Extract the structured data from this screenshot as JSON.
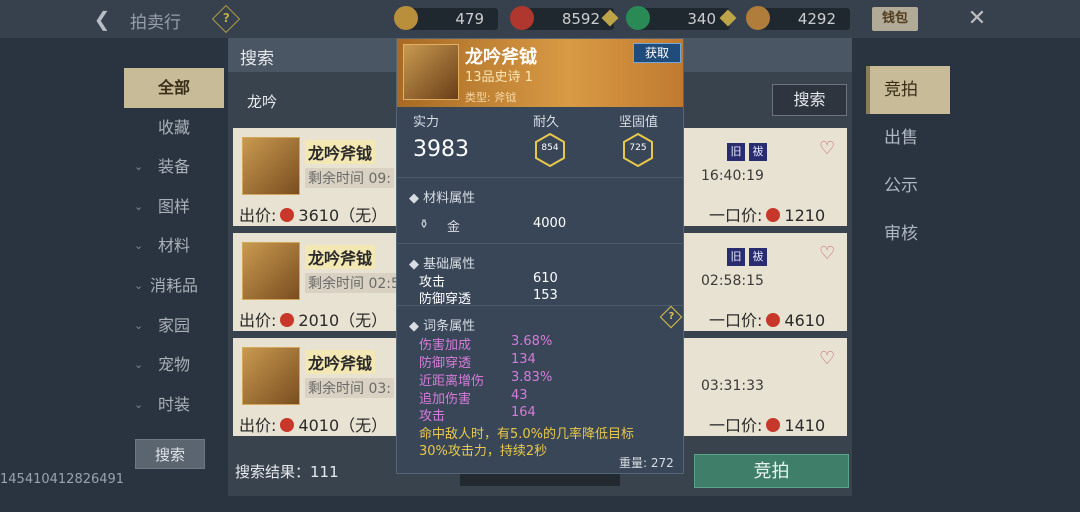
{
  "header": {
    "title": "拍卖行",
    "currencies": [
      "479",
      "8592",
      "340",
      "4292"
    ],
    "wallet_label": "钱包"
  },
  "nav": {
    "categories": [
      "全部",
      "收藏",
      "装备",
      "图样",
      "材料",
      "消耗品",
      "家园",
      "宠物",
      "时装"
    ],
    "search_label": "搜索"
  },
  "uid": "145410412826491",
  "main": {
    "panel_title": "搜索",
    "keyword": "龙吟",
    "search_label": "搜索",
    "result_text": "搜索结果：111",
    "bid_button": "竞拍",
    "cards": [
      {
        "name": "龙吟斧钺",
        "remain": "剩余时间",
        "remain_val": "09:",
        "end_time": "16:40:19",
        "bid": "出价:",
        "bid_val": "3610（无）",
        "buyout": "一口价:",
        "buyout_val": "1210",
        "tag1": "旧",
        "tag2": "祓"
      },
      {
        "name": "龙吟斧钺",
        "remain": "剩余时间",
        "remain_val": "02:5",
        "end_time": "02:58:15",
        "bid": "出价:",
        "bid_val": "2010（无）",
        "buyout": "一口价:",
        "buyout_val": "4610",
        "tag1": "旧",
        "tag2": "祓"
      },
      {
        "name": "龙吟斧钺",
        "remain": "剩余时间",
        "remain_val": "03:",
        "end_time": "03:31:33",
        "bid": "出价:",
        "bid_val": "4010（无）",
        "buyout": "一口价:",
        "buyout_val": "1410",
        "tag1": "",
        "tag2": ""
      }
    ]
  },
  "right_tabs": [
    "竞拍",
    "出售",
    "公示",
    "审核"
  ],
  "popup": {
    "name": "龙吟斧钺",
    "grade": "13品史诗 1",
    "type": "类型: 斧钺",
    "acquire": "获取",
    "power_label": "实力",
    "power": "3983",
    "durability_label": "耐久",
    "durability": "854",
    "sturdiness_label": "坚固值",
    "sturdiness": "725",
    "material_title": "材料属性",
    "material_name": "金",
    "material_val": "4000",
    "base_title": "基础属性",
    "base": [
      {
        "k": "攻击",
        "v": "610"
      },
      {
        "k": "防御穿透",
        "v": "153"
      }
    ],
    "affix_title": "词条属性",
    "affixes": [
      {
        "k": "伤害加成",
        "v": "3.68%"
      },
      {
        "k": "防御穿透",
        "v": "134"
      },
      {
        "k": "近距离增伤",
        "v": "3.83%"
      },
      {
        "k": "追加伤害",
        "v": "43"
      },
      {
        "k": "攻击",
        "v": "164"
      }
    ],
    "effect_line1": "命中敌人时，有5.0%的几率降低目标",
    "effect_line2": "30%攻击力，持续2秒",
    "weight": "重量: 272"
  },
  "colors": {
    "accent_gold": "#c8bc98",
    "purple_text": "#d47cd8",
    "yellow_text": "#e8c84a",
    "bid_green": "#3f7f6a"
  }
}
